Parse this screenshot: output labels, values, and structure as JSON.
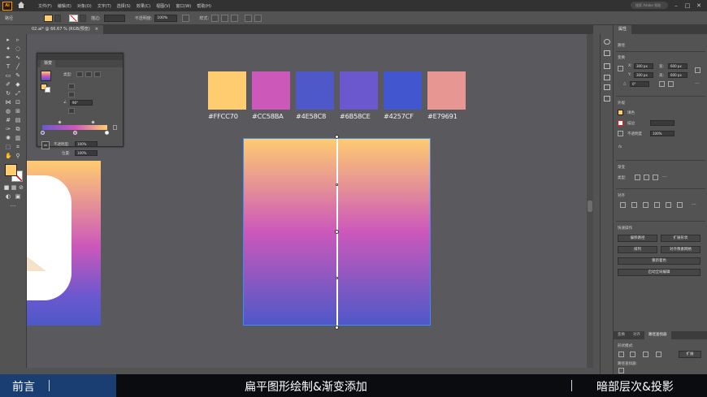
{
  "menubar": {
    "logo": "Ai",
    "items": [
      "文件(F)",
      "编辑(E)",
      "对象(O)",
      "文字(T)",
      "选择(S)",
      "效果(C)",
      "视图(V)",
      "窗口(W)",
      "帮助(H)"
    ],
    "search_placeholder": "搜索 Adobe 帮助",
    "win_min": "–",
    "win_max": "□",
    "win_close": "✕"
  },
  "controlbar": {
    "path_label": "路径",
    "stroke_label": "描边:",
    "opacity_label": "不透明度:",
    "opacity_value": "100%",
    "style_label": "样式:",
    "doc_setup_label": "文档设置",
    "fill_color": "#FFCC70"
  },
  "document": {
    "tab_title": "02.ai* @ 66.67 % (RGB/预览)",
    "tab_close": "×"
  },
  "swatches": [
    {
      "hex": "#FFCC70",
      "label": "#FFCC70"
    },
    {
      "hex": "#CC58BA",
      "label": "#CC58BA"
    },
    {
      "hex": "#4E58C8",
      "label": "#4E58C8"
    },
    {
      "hex": "#6B58CE",
      "label": "#6B58CE"
    },
    {
      "hex": "#4257CF",
      "label": "#4257CF"
    },
    {
      "hex": "#E79691",
      "label": "#E79691"
    }
  ],
  "gradient_panel": {
    "title": "渐变",
    "type_label": "类型:",
    "angle_value": "90°",
    "opacity_label": "不透明度:",
    "opacity_value": "100%",
    "location_label": "位置:",
    "location_value": "100%"
  },
  "properties": {
    "tab": "属性",
    "section_path": "路径",
    "section_transform": "变换",
    "x_label": "X:",
    "x_value": "300 px",
    "y_label": "Y:",
    "y_value": "300 px",
    "w_label": "宽:",
    "w_value": "600 px",
    "h_label": "高:",
    "h_value": "600 px",
    "rotate_value": "0°",
    "section_appearance": "外观",
    "fill_label": "填色",
    "stroke_label": "描边",
    "opacity_label": "不透明度",
    "opacity_value": "100%",
    "fx_label": "fx",
    "section_gradient": "渐变",
    "gradient_type_label": "类型:",
    "section_align": "对齐",
    "section_quick": "快速操作",
    "btn_offset_path": "偏移路径",
    "btn_expand": "扩展形状",
    "btn_arrange": "排列",
    "btn_recolor": "重新着色",
    "btn_align_pixel": "对齐像素网格",
    "btn_global_edit": "启动全局编辑",
    "bottom_tabs": [
      "变换",
      "对齐",
      "路径查找器"
    ],
    "shape_mode_label": "形状模式:",
    "pathfinder_label": "路径查找器:",
    "expand_btn": "扩展"
  },
  "banner": {
    "left": "前言",
    "center": "扁平图形绘制&渐变添加",
    "right": "暗部层次&投影"
  }
}
